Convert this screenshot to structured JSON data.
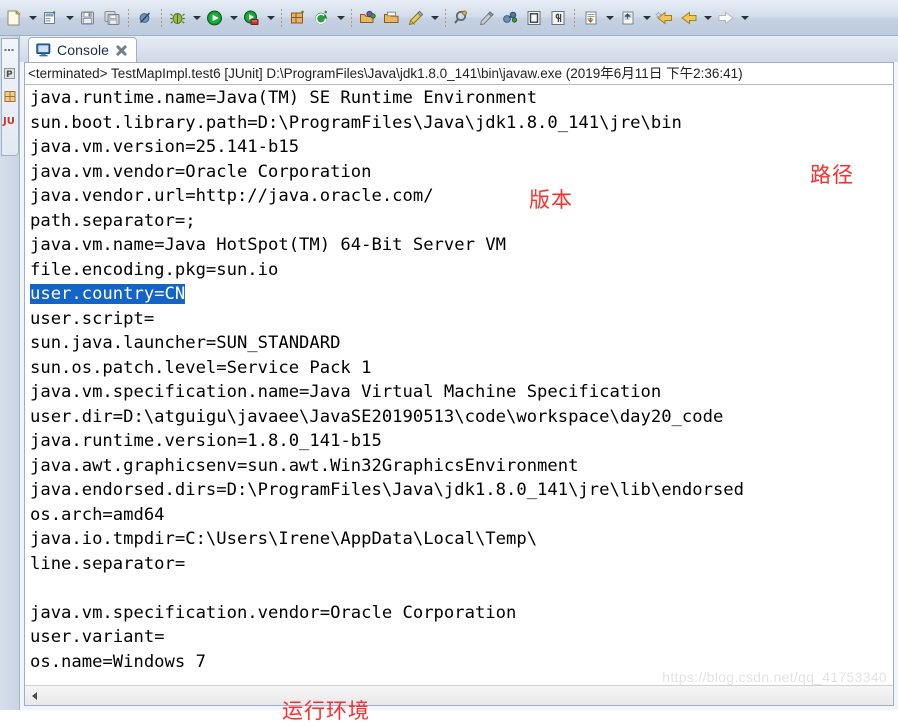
{
  "toolbar": {
    "items": [
      {
        "name": "new-wizard-button",
        "icon": "new-file-icon",
        "dropdown": true
      },
      {
        "name": "new-java-project-button",
        "icon": "new-project-icon",
        "dropdown": true
      },
      {
        "name": "save-button",
        "icon": "save-icon",
        "dropdown": false
      },
      {
        "name": "save-all-button",
        "icon": "save-all-icon",
        "dropdown": false
      },
      {
        "name": "separator-1",
        "icon": "separator",
        "dropdown": false
      },
      {
        "name": "skip-all-breakpoints-button",
        "icon": "skip-breakpoints-icon",
        "dropdown": false
      },
      {
        "name": "separator-2",
        "icon": "separator",
        "dropdown": false
      },
      {
        "name": "debug-button",
        "icon": "debug-bug-icon",
        "dropdown": true
      },
      {
        "name": "run-button",
        "icon": "run-play-icon",
        "dropdown": true
      },
      {
        "name": "coverage-button",
        "icon": "coverage-icon",
        "dropdown": true
      },
      {
        "name": "separator-3",
        "icon": "separator",
        "dropdown": false
      },
      {
        "name": "new-package-button",
        "icon": "new-package-icon",
        "dropdown": false
      },
      {
        "name": "new-class-button",
        "icon": "new-class-icon",
        "dropdown": true
      },
      {
        "name": "separator-4",
        "icon": "separator",
        "dropdown": false
      },
      {
        "name": "open-type-button",
        "icon": "open-type-icon",
        "dropdown": false
      },
      {
        "name": "open-task-button",
        "icon": "open-task-icon",
        "dropdown": false
      },
      {
        "name": "edit-button",
        "icon": "pencil-icon",
        "dropdown": true
      },
      {
        "name": "separator-5",
        "icon": "separator",
        "dropdown": false
      },
      {
        "name": "search-button",
        "icon": "search-icon",
        "dropdown": false
      },
      {
        "name": "annotation-button",
        "icon": "annotation-icon",
        "dropdown": false
      },
      {
        "name": "link-button",
        "icon": "link-icon",
        "dropdown": false
      },
      {
        "name": "toggle-block-selection-button",
        "icon": "block-selection-icon",
        "dropdown": false
      },
      {
        "name": "show-whitespace-button",
        "icon": "pilcrow-icon",
        "dropdown": false
      },
      {
        "name": "separator-6",
        "icon": "separator",
        "dropdown": false
      },
      {
        "name": "previous-annotation-button",
        "icon": "prev-annotation-icon",
        "dropdown": true
      },
      {
        "name": "next-annotation-button",
        "icon": "next-annotation-icon",
        "dropdown": true
      },
      {
        "name": "back-to-button",
        "icon": "back-star-icon",
        "dropdown": false
      },
      {
        "name": "back-button",
        "icon": "back-arrow-icon",
        "dropdown": true
      },
      {
        "name": "forward-button",
        "icon": "forward-arrow-icon",
        "dropdown": true
      }
    ]
  },
  "left_bar": {
    "items": [
      {
        "name": "restore-icon",
        "label": ""
      },
      {
        "name": "package-explorer-icon",
        "label": "P"
      },
      {
        "name": "outline-icon",
        "label": ""
      },
      {
        "name": "junit-icon",
        "label": "JU"
      }
    ]
  },
  "console": {
    "tab_label": "Console",
    "tab_icon": "console-monitor-icon",
    "close_icon": "close-icon",
    "terminated_line": "<terminated> TestMapImpl.test6 [JUnit] D:\\ProgramFiles\\Java\\jdk1.8.0_141\\bin\\javaw.exe (2019年6月11日 下午2:36:41)",
    "selection_color": "#1464c8",
    "lines": [
      {
        "text": "java.runtime.name=Java(TM) SE Runtime Environment",
        "selected": false
      },
      {
        "text": "sun.boot.library.path=D:\\ProgramFiles\\Java\\jdk1.8.0_141\\jre\\bin",
        "selected": false
      },
      {
        "text": "java.vm.version=25.141-b15",
        "selected": false
      },
      {
        "text": "java.vm.vendor=Oracle Corporation",
        "selected": false
      },
      {
        "text": "java.vendor.url=http://java.oracle.com/",
        "selected": false
      },
      {
        "text": "path.separator=;",
        "selected": false
      },
      {
        "text": "java.vm.name=Java HotSpot(TM) 64-Bit Server VM",
        "selected": false
      },
      {
        "text": "file.encoding.pkg=sun.io",
        "selected": false
      },
      {
        "text": "user.country=CN",
        "selected": true
      },
      {
        "text": "user.script=",
        "selected": false
      },
      {
        "text": "sun.java.launcher=SUN_STANDARD",
        "selected": false
      },
      {
        "text": "sun.os.patch.level=Service Pack 1",
        "selected": false
      },
      {
        "text": "java.vm.specification.name=Java Virtual Machine Specification",
        "selected": false
      },
      {
        "text": "user.dir=D:\\atguigu\\javaee\\JavaSE20190513\\code\\workspace\\day20_code",
        "selected": false
      },
      {
        "text": "java.runtime.version=1.8.0_141-b15",
        "selected": false
      },
      {
        "text": "java.awt.graphicsenv=sun.awt.Win32GraphicsEnvironment",
        "selected": false
      },
      {
        "text": "java.endorsed.dirs=D:\\ProgramFiles\\Java\\jdk1.8.0_141\\jre\\lib\\endorsed",
        "selected": false
      },
      {
        "text": "os.arch=amd64",
        "selected": false
      },
      {
        "text": "java.io.tmpdir=C:\\Users\\Irene\\AppData\\Local\\Temp\\",
        "selected": false
      },
      {
        "text": "line.separator=",
        "selected": false
      },
      {
        "text": "",
        "selected": false
      },
      {
        "text": "java.vm.specification.vendor=Oracle Corporation",
        "selected": false
      },
      {
        "text": "user.variant=",
        "selected": false
      },
      {
        "text": "os.name=Windows 7",
        "selected": false
      }
    ]
  },
  "annotations": {
    "color": "#ff2d2d",
    "path": "路径",
    "version": "版本",
    "environment": "运行环境"
  },
  "scrollbar": {
    "left_arrow_icon": "scroll-left-arrow-icon"
  },
  "watermark": {
    "text": "https://blog.csdn.net/qq_41753340"
  }
}
